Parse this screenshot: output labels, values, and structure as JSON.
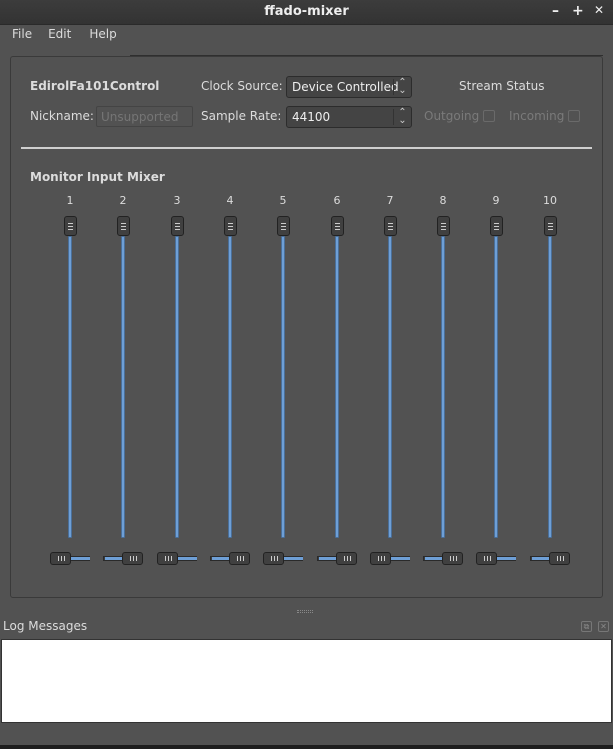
{
  "window": {
    "title": "ffado-mixer",
    "minimize": "–",
    "maximize": "+",
    "close": "✕"
  },
  "menu": [
    "File",
    "Edit",
    "Help"
  ],
  "device": {
    "name": "EdirolFa101Control",
    "nickname_label": "Nickname:",
    "nickname_placeholder": "Unsupported",
    "clock_label": "Clock Source:",
    "clock_value": "Device Controlled",
    "rate_label": "Sample Rate:",
    "rate_value": "44100",
    "stream_status": "Stream Status",
    "outgoing": "Outgoing",
    "incoming": "Incoming"
  },
  "mixer": {
    "title": "Monitor Input Mixer",
    "channels": [
      {
        "label": "1",
        "fader": 1.0,
        "pan": 0
      },
      {
        "label": "2",
        "fader": 1.0,
        "pan": 1
      },
      {
        "label": "3",
        "fader": 1.0,
        "pan": 0
      },
      {
        "label": "4",
        "fader": 1.0,
        "pan": 1
      },
      {
        "label": "5",
        "fader": 1.0,
        "pan": 0
      },
      {
        "label": "6",
        "fader": 1.0,
        "pan": 1
      },
      {
        "label": "7",
        "fader": 1.0,
        "pan": 0
      },
      {
        "label": "8",
        "fader": 1.0,
        "pan": 1
      },
      {
        "label": "9",
        "fader": 1.0,
        "pan": 0
      },
      {
        "label": "10",
        "fader": 1.0,
        "pan": 1
      }
    ]
  },
  "log": {
    "title": "Log Messages",
    "float": "⧉",
    "close": "✕"
  },
  "colors": {
    "accent": "#6e9fd6",
    "background": "#525252"
  }
}
